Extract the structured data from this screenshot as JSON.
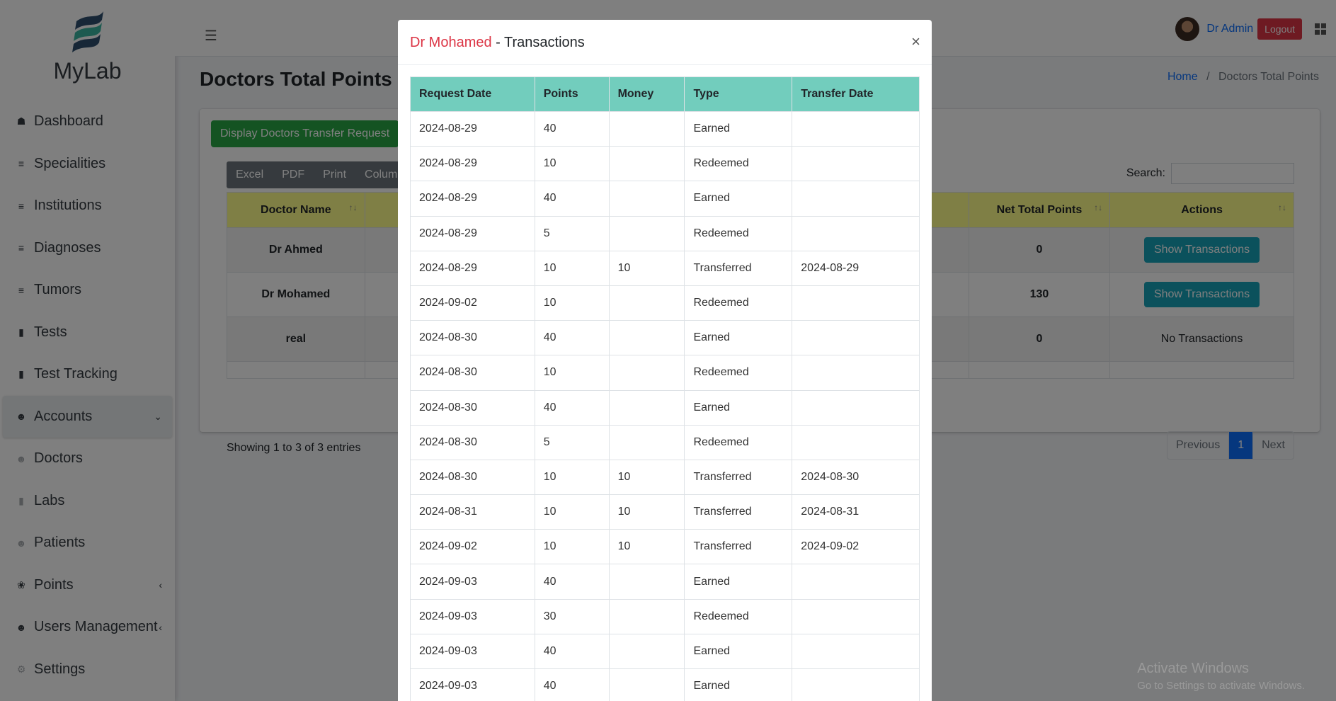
{
  "brand": {
    "name": "MyLab"
  },
  "sidebar": {
    "items": [
      {
        "label": "Dashboard",
        "icon": "dashboard-icon",
        "glyph": "☗"
      },
      {
        "label": "Specialities",
        "icon": "list-icon",
        "glyph": "≡"
      },
      {
        "label": "Institutions",
        "icon": "list-icon",
        "glyph": "≡"
      },
      {
        "label": "Diagnoses",
        "icon": "list-icon",
        "glyph": "≡"
      },
      {
        "label": "Tumors",
        "icon": "list-icon",
        "glyph": "≡"
      },
      {
        "label": "Tests",
        "icon": "bookmark-icon",
        "glyph": "▮"
      },
      {
        "label": "Test Tracking",
        "icon": "bookmark-icon",
        "glyph": "▮"
      },
      {
        "label": "Accounts",
        "icon": "accounts-icon",
        "glyph": "☻",
        "expanded": true
      },
      {
        "label": "Doctors",
        "icon": "user-icon",
        "glyph": "☻"
      },
      {
        "label": "Labs",
        "icon": "bookmark-icon",
        "glyph": "▮"
      },
      {
        "label": "Patients",
        "icon": "user-icon",
        "glyph": "☻"
      },
      {
        "label": "Points",
        "icon": "coins-icon",
        "glyph": "❀"
      },
      {
        "label": "Users Management",
        "icon": "users-icon",
        "glyph": "☻"
      },
      {
        "label": "Settings",
        "icon": "gear-icon",
        "glyph": "⚙"
      }
    ]
  },
  "topbar": {
    "user_name": "Dr Admin",
    "logout_label": "Logout"
  },
  "page": {
    "title": "Doctors Total Points",
    "breadcrumb": {
      "home": "Home",
      "separator": "/",
      "current": "Doctors Total Points"
    },
    "display_button": "Display Doctors Transfer Request",
    "export_buttons": [
      "Excel",
      "PDF",
      "Print",
      "Column v"
    ],
    "search_label": "Search:",
    "columns": {
      "doctor_name": "Doctor Name",
      "net_total": "Net Total Points",
      "actions": "Actions"
    },
    "rows": [
      {
        "doctor": "Dr Ahmed",
        "net": "0",
        "action": "Show Transactions"
      },
      {
        "doctor": "Dr Mohamed",
        "net": "130",
        "action": "Show Transactions"
      },
      {
        "doctor": "real",
        "net": "0",
        "action": "No Transactions"
      }
    ],
    "showing": "Showing 1 to 3 of 3 entries",
    "pager": {
      "previous": "Previous",
      "page": "1",
      "next": "Next"
    }
  },
  "watermark": {
    "title": "Activate Windows",
    "subtitle": "Go to Settings to activate Windows."
  },
  "modal": {
    "doctor": "Dr Mohamed",
    "title_suffix": " - Transactions",
    "close": "×",
    "columns": [
      "Request Date",
      "Points",
      "Money",
      "Type",
      "Transfer Date"
    ],
    "rows": [
      [
        "2024-08-29",
        "40",
        "",
        "Earned",
        ""
      ],
      [
        "2024-08-29",
        "10",
        "",
        "Redeemed",
        ""
      ],
      [
        "2024-08-29",
        "40",
        "",
        "Earned",
        ""
      ],
      [
        "2024-08-29",
        "5",
        "",
        "Redeemed",
        ""
      ],
      [
        "2024-08-29",
        "10",
        "10",
        "Transferred",
        "2024-08-29"
      ],
      [
        "2024-09-02",
        "10",
        "",
        "Redeemed",
        ""
      ],
      [
        "2024-08-30",
        "40",
        "",
        "Earned",
        ""
      ],
      [
        "2024-08-30",
        "10",
        "",
        "Redeemed",
        ""
      ],
      [
        "2024-08-30",
        "40",
        "",
        "Earned",
        ""
      ],
      [
        "2024-08-30",
        "5",
        "",
        "Redeemed",
        ""
      ],
      [
        "2024-08-30",
        "10",
        "10",
        "Transferred",
        "2024-08-30"
      ],
      [
        "2024-08-31",
        "10",
        "10",
        "Transferred",
        "2024-08-31"
      ],
      [
        "2024-09-02",
        "10",
        "10",
        "Transferred",
        "2024-09-02"
      ],
      [
        "2024-09-03",
        "40",
        "",
        "Earned",
        ""
      ],
      [
        "2024-09-03",
        "30",
        "",
        "Redeemed",
        ""
      ],
      [
        "2024-09-03",
        "40",
        "",
        "Earned",
        ""
      ],
      [
        "2024-09-03",
        "40",
        "",
        "Earned",
        ""
      ]
    ]
  }
}
